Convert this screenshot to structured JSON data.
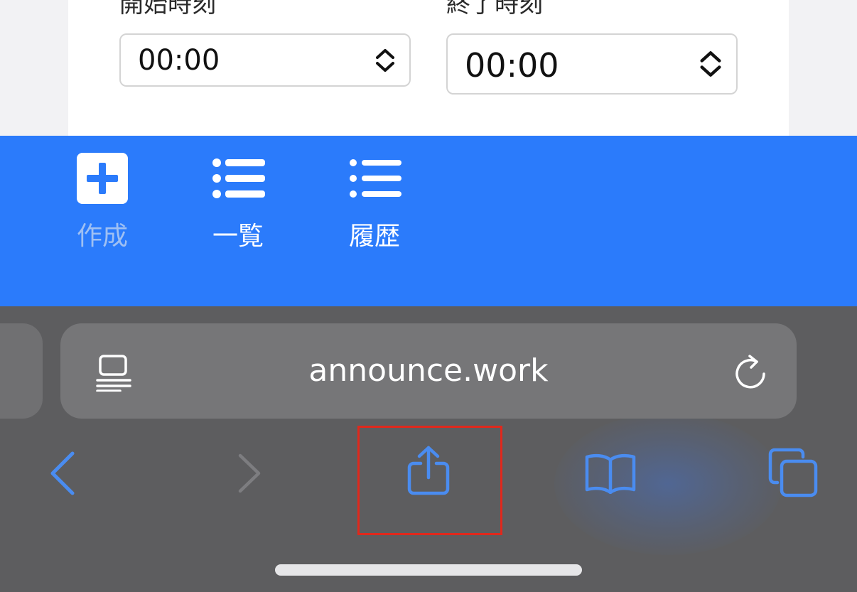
{
  "form": {
    "start_label": "開始時刻",
    "start_value": "00:00",
    "end_label": "終了時刻",
    "end_value": "00:00"
  },
  "nav": {
    "items": [
      {
        "label": "作成",
        "icon": "plus-square-icon",
        "active": false
      },
      {
        "label": "一覧",
        "icon": "list-icon",
        "active": true
      },
      {
        "label": "履歴",
        "icon": "list-icon",
        "active": true
      }
    ]
  },
  "browser": {
    "url": "announce.work",
    "toolbar": [
      "back-icon",
      "forward-icon",
      "share-icon",
      "bookmarks-icon",
      "tabs-icon"
    ]
  },
  "colors": {
    "nav_bg": "#2b7bfb",
    "browser_bg": "#5d5d5f",
    "tool_accent": "#4a8cf0",
    "highlight": "#e0281c"
  }
}
